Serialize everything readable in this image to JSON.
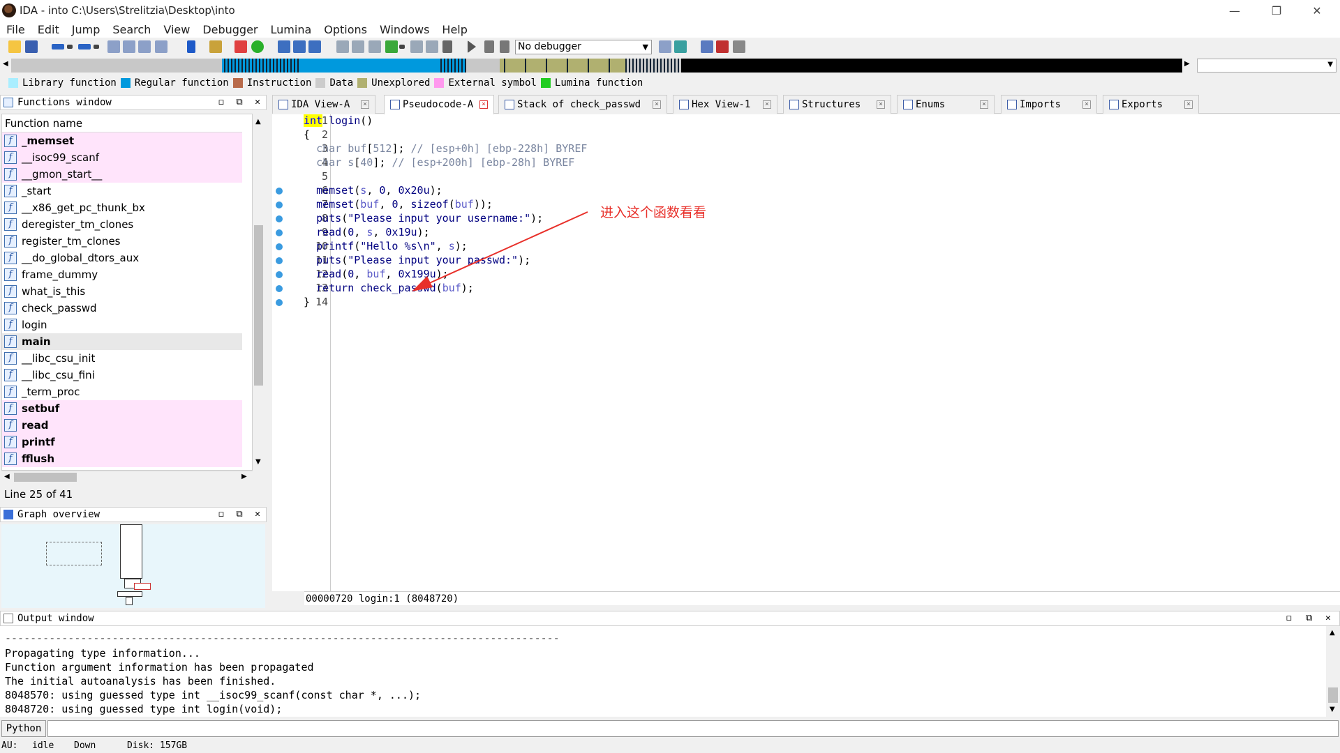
{
  "window": {
    "title": "IDA - into C:\\Users\\Strelitzia\\Desktop\\into",
    "minimize": "—",
    "restore": "❐",
    "close": "✕"
  },
  "menu": [
    "File",
    "Edit",
    "Jump",
    "Search",
    "View",
    "Debugger",
    "Lumina",
    "Options",
    "Windows",
    "Help"
  ],
  "toolbar": {
    "debugger_value": "No debugger"
  },
  "legend": [
    {
      "label": "Library function",
      "color": "#aaeeff"
    },
    {
      "label": "Regular function",
      "color": "#0099dd"
    },
    {
      "label": "Instruction",
      "color": "#b86a4a"
    },
    {
      "label": "Data",
      "color": "#cccccc"
    },
    {
      "label": "Unexplored",
      "color": "#b0b070"
    },
    {
      "label": "External symbol",
      "color": "#ff99ee"
    },
    {
      "label": "Lumina function",
      "color": "#22cc22"
    }
  ],
  "functions_window": {
    "title": "Functions window",
    "column": "Function name",
    "items": [
      {
        "name": "_memset",
        "bold": true,
        "pink": true
      },
      {
        "name": "__isoc99_scanf",
        "bold": false,
        "pink": true
      },
      {
        "name": "__gmon_start__",
        "bold": false,
        "pink": true
      },
      {
        "name": "_start",
        "bold": false,
        "pink": false
      },
      {
        "name": "__x86_get_pc_thunk_bx",
        "bold": false,
        "pink": false
      },
      {
        "name": "deregister_tm_clones",
        "bold": false,
        "pink": false
      },
      {
        "name": "register_tm_clones",
        "bold": false,
        "pink": false
      },
      {
        "name": "__do_global_dtors_aux",
        "bold": false,
        "pink": false
      },
      {
        "name": "frame_dummy",
        "bold": false,
        "pink": false
      },
      {
        "name": "what_is_this",
        "bold": false,
        "pink": false
      },
      {
        "name": "check_passwd",
        "bold": false,
        "pink": false
      },
      {
        "name": "login",
        "bold": false,
        "pink": false
      },
      {
        "name": "main",
        "bold": true,
        "pink": false,
        "selected": true
      },
      {
        "name": "__libc_csu_init",
        "bold": false,
        "pink": false
      },
      {
        "name": "__libc_csu_fini",
        "bold": false,
        "pink": false
      },
      {
        "name": "_term_proc",
        "bold": false,
        "pink": false
      },
      {
        "name": "setbuf",
        "bold": true,
        "pink": true
      },
      {
        "name": "read",
        "bold": true,
        "pink": true
      },
      {
        "name": "printf",
        "bold": true,
        "pink": true
      },
      {
        "name": "fflush",
        "bold": true,
        "pink": true
      }
    ],
    "status": "Line 25 of 41"
  },
  "graph_overview": {
    "title": "Graph overview"
  },
  "tabs": [
    {
      "label": "IDA View-A",
      "active": false
    },
    {
      "label": "Pseudocode-A",
      "active": true
    },
    {
      "label": "Stack of check_passwd",
      "active": false
    },
    {
      "label": "Hex View-1",
      "active": false
    },
    {
      "label": "Structures",
      "active": false
    },
    {
      "label": "Enums",
      "active": false
    },
    {
      "label": "Imports",
      "active": false
    },
    {
      "label": "Exports",
      "active": false
    }
  ],
  "code": {
    "lines": [
      "1",
      "2",
      "3",
      "4",
      "5",
      "6",
      "7",
      "8",
      "9",
      "10",
      "11",
      "12",
      "13",
      "14"
    ],
    "status": "00000720 login:1 (8048720)"
  },
  "annotation": "进入这个函数看看",
  "output_window": {
    "title": "Output window",
    "lines": [
      "----------------------------------------------------------------------------------------",
      "Propagating type information...",
      "Function argument information has been propagated",
      "The initial autoanalysis has been finished.",
      "8048570: using guessed type int __isoc99_scanf(const char *, ...);",
      "8048720: using guessed type int login(void);"
    ],
    "python_button": "Python"
  },
  "statusbar": {
    "au_label": "AU:",
    "au_value": "idle",
    "direction": "Down",
    "disk": "Disk: 157GB"
  }
}
